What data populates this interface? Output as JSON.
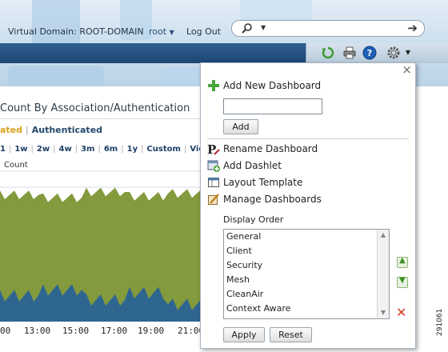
{
  "header": {
    "virtual_domain": "Virtual Domain: ROOT-DOMAIN",
    "user": "root",
    "user_caret": "▼",
    "logout": "Log Out",
    "search_placeholder": ""
  },
  "toolbar": {
    "icons": [
      "refresh-icon",
      "print-icon",
      "help-icon",
      "gear-icon"
    ]
  },
  "chart": {
    "title": "Count By Association/Authentication",
    "legend_association": "ated",
    "legend_separator": "|",
    "legend_authentication": "Authenticated",
    "time_ranges": [
      "1",
      "1w",
      "2w",
      "4w",
      "3m",
      "6m",
      "1y",
      "Custom",
      "View"
    ],
    "ylabel": "Count",
    "x_ticks": [
      "00",
      "13:00",
      "15:00",
      "17:00",
      "19:00",
      "21:00"
    ],
    "figure_id": "291061"
  },
  "chart_data": {
    "type": "area",
    "x": [
      "13:00",
      "15:00",
      "17:00",
      "19:00",
      "21:00"
    ],
    "series": [
      {
        "name": "Authenticated",
        "values": [
          88,
          86,
          90,
          87,
          89
        ]
      },
      {
        "name": "",
        "values": [
          18,
          22,
          15,
          20,
          12
        ]
      }
    ],
    "colors": [
      "#839a3d",
      "#2f6690"
    ]
  },
  "popup": {
    "close": "×",
    "add_new_dashboard": "Add New Dashboard",
    "dashboard_name_value": "",
    "add_button": "Add",
    "rename_dashboard": "Rename Dashboard",
    "add_dashlet": "Add Dashlet",
    "layout_template": "Layout Template",
    "manage_dashboards": "Manage Dashboards",
    "display_order_label": "Display Order",
    "display_order_items": [
      "General",
      "Client",
      "Security",
      "Mesh",
      "CleanAir",
      "Context Aware"
    ],
    "apply_button": "Apply",
    "reset_button": "Reset"
  },
  "colors": {
    "navbar": "#1d4573",
    "assoc": "#d9a11c",
    "auth_link": "#23486c",
    "area_green": "#839a3d",
    "area_blue": "#2f6690",
    "delete_red": "#d2391c"
  }
}
